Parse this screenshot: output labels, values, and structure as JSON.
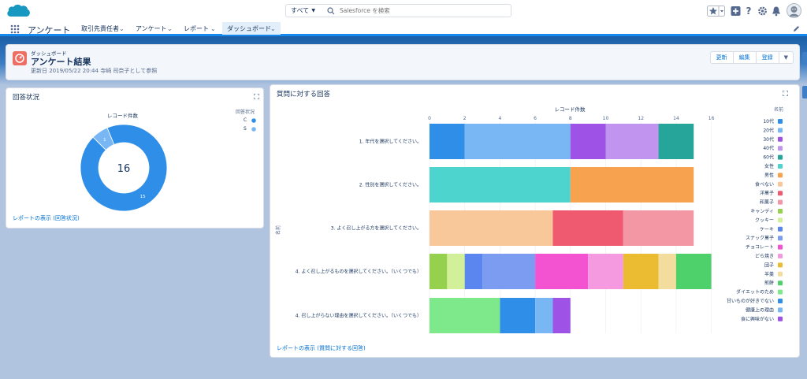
{
  "app": {
    "name": "アンケート"
  },
  "search": {
    "scope": "すべて",
    "placeholder": "Salesforce を検索"
  },
  "header_icons": [
    "star-icon",
    "add-icon",
    "help-icon",
    "gear-icon",
    "bell-icon",
    "avatar"
  ],
  "nav": {
    "tabs": [
      {
        "label": "取引先責任者"
      },
      {
        "label": "アンケート"
      },
      {
        "label": "レポート"
      },
      {
        "label": "ダッシュボード",
        "active": true
      }
    ]
  },
  "dashboard": {
    "kicker": "ダッシュボード",
    "title": "アンケート結果",
    "meta": "更新日 2019/05/22 20:44 寺崎 司奈子として参照",
    "buttons": {
      "refresh": "更新",
      "edit": "編集",
      "subscribe": "登録"
    }
  },
  "card1": {
    "title": "回答状況",
    "link": "レポートの表示 (回答状況)",
    "colors": {
      "C": "#2f8fe8",
      "S": "#78b7f4"
    },
    "chart_data": {
      "type": "pie",
      "subtitle": "レコード件数",
      "center_total": "16",
      "legend_title": "回答状況",
      "slices": [
        {
          "name": "C",
          "value": 15,
          "color": "#2f8fe8"
        },
        {
          "name": "S",
          "value": 1,
          "color": "#78b7f4"
        }
      ]
    }
  },
  "card2": {
    "title": "質問に対する回答",
    "link": "レポートの表示 (質問に対する回答)",
    "chart_data": {
      "type": "bar",
      "orientation": "horizontal",
      "stacked": true,
      "xlabel": "レコード件数",
      "ylabel": "名前",
      "xlim": [
        0,
        16
      ],
      "xticks": [
        0,
        2,
        4,
        6,
        8,
        10,
        12,
        14,
        16
      ],
      "legend_title": "名前",
      "categories": [
        "1. 年代を選択してください。",
        "2. 性別を選択してください。",
        "3. よく召し上がる方を選択してください。",
        "4. よく召し上がるものを選択してください。（いくつでも）",
        "4. 召し上がらない理由を選択してください。（いくつでも）"
      ],
      "series": [
        {
          "name": "10代",
          "color": "#2f8fe8",
          "values": [
            2,
            0,
            0,
            0,
            0
          ]
        },
        {
          "name": "20代",
          "color": "#78b7f4",
          "values": [
            6,
            0,
            0,
            0,
            0
          ]
        },
        {
          "name": "30代",
          "color": "#9e52e6",
          "values": [
            2,
            0,
            0,
            0,
            0
          ]
        },
        {
          "name": "40代",
          "color": "#c195ef",
          "values": [
            3,
            0,
            0,
            0,
            0
          ]
        },
        {
          "name": "60代",
          "color": "#26a69a",
          "values": [
            2,
            0,
            0,
            0,
            0
          ]
        },
        {
          "name": "女性",
          "color": "#4dd4cf",
          "values": [
            0,
            8,
            0,
            0,
            0
          ]
        },
        {
          "name": "男性",
          "color": "#f6a24e",
          "values": [
            0,
            7,
            0,
            0,
            0
          ]
        },
        {
          "name": "食べない",
          "color": "#f8c89b",
          "values": [
            0,
            0,
            7,
            0,
            0
          ]
        },
        {
          "name": "洋菓子",
          "color": "#ef5a71",
          "values": [
            0,
            0,
            4,
            0,
            0
          ]
        },
        {
          "name": "和菓子",
          "color": "#f397a5",
          "values": [
            0,
            0,
            4,
            0,
            0
          ]
        },
        {
          "name": "キャンディ",
          "color": "#95d14c",
          "values": [
            0,
            0,
            0,
            1,
            0
          ]
        },
        {
          "name": "クッキー",
          "color": "#d2f09a",
          "values": [
            0,
            0,
            0,
            1,
            0
          ]
        },
        {
          "name": "ケーキ",
          "color": "#5c86ef",
          "values": [
            0,
            0,
            0,
            1,
            0
          ]
        },
        {
          "name": "スナック菓子",
          "color": "#7b9cf0",
          "values": [
            0,
            0,
            0,
            3,
            0
          ]
        },
        {
          "name": "チョコレート",
          "color": "#f352d1",
          "values": [
            0,
            0,
            0,
            3,
            0
          ]
        },
        {
          "name": "どら焼き",
          "color": "#f59ae1",
          "values": [
            0,
            0,
            0,
            2,
            0
          ]
        },
        {
          "name": "団子",
          "color": "#ebbc32",
          "values": [
            0,
            0,
            0,
            2,
            0
          ]
        },
        {
          "name": "羊羹",
          "color": "#f3dd9e",
          "values": [
            0,
            0,
            0,
            1,
            0
          ]
        },
        {
          "name": "煎餅",
          "color": "#4ed16b",
          "values": [
            0,
            0,
            0,
            2,
            0
          ]
        },
        {
          "name": "ダイエットのため",
          "color": "#7ee98b",
          "values": [
            0,
            0,
            0,
            0,
            4
          ]
        },
        {
          "name": "甘いものが好きでない",
          "color": "#2f8fe8",
          "values": [
            0,
            0,
            0,
            0,
            2
          ]
        },
        {
          "name": "健康上の理由",
          "color": "#78b7f4",
          "values": [
            0,
            0,
            0,
            0,
            1
          ]
        },
        {
          "name": "食に興味がない",
          "color": "#9e52e6",
          "values": [
            0,
            0,
            0,
            0,
            1
          ]
        }
      ]
    }
  }
}
